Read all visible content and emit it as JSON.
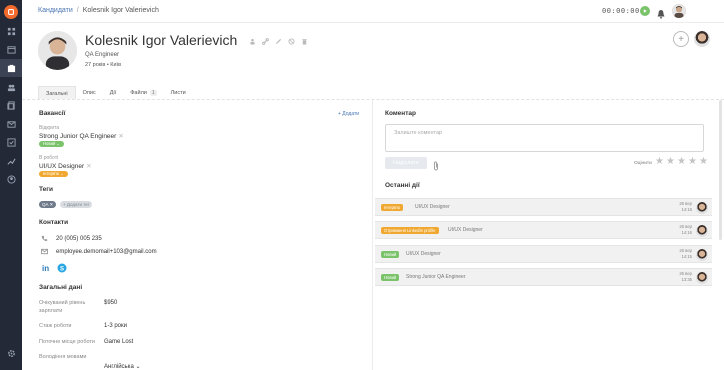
{
  "breadcrumb": {
    "parent": "Кандидати",
    "separator": "/",
    "current": "Kolesnik Igor Valerievich"
  },
  "timer": "00:00:00",
  "profile": {
    "name": "Kolesnik Igor Valerievich",
    "role": "QA Engineer",
    "meta": "27 років • Київ"
  },
  "tabs": [
    {
      "label": "Загальні",
      "active": true
    },
    {
      "label": "Опис"
    },
    {
      "label": "Дії"
    },
    {
      "label": "Файли",
      "badge": "1"
    },
    {
      "label": "Листи"
    }
  ],
  "vacancies": {
    "title": "Вакансії",
    "add": "+ Додати",
    "items": [
      {
        "status_label": "Відкрита",
        "title": "Strong Junior QA Engineer",
        "stage": "Новий ⌄",
        "stage_color": "#7ac36a"
      },
      {
        "status_label": "В роботі",
        "title": "UI/UX Designer",
        "stage": "Інтерв'ю ⌄",
        "stage_color": "#f0a830"
      }
    ]
  },
  "tags": {
    "title": "Теги",
    "items": [
      "QA ✕",
      "+ Додати тег"
    ]
  },
  "contacts": {
    "title": "Контакти",
    "phone": "20 (005) 005 235",
    "email": "employee.demomail+103@gmail.com"
  },
  "general": {
    "title": "Загальні дані",
    "fields": [
      {
        "label": "Очікуваний рівень зарплати",
        "value": "$950"
      },
      {
        "label": "Стаж роботи",
        "value": "1-3 роки"
      },
      {
        "label": "Поточне місце роботи",
        "value": "Game Lost"
      },
      {
        "label": "Володіння мовами",
        "value": "Англійська ⌄"
      }
    ]
  },
  "comment": {
    "title": "Коментар",
    "placeholder": "Залиште коментар",
    "publish": "Надіслати",
    "rate_label": "Оцінити",
    "stars": 5
  },
  "recent": {
    "title": "Останні дії",
    "items": [
      {
        "pill": "Інтерв'ю",
        "pill_color": "orange",
        "text": "UI/UX Designer",
        "date_day": "26 вер",
        "date_time": "14:16"
      },
      {
        "pill": "Отримання LinkedIn profile",
        "pill_color": "orange",
        "text": "UI/UX Designer",
        "date_day": "26 вер",
        "date_time": "14:16"
      },
      {
        "pill": "Новий",
        "pill_color": "green",
        "text": "UI/UX Designer",
        "date_day": "26 вер",
        "date_time": "14:15"
      },
      {
        "pill": "Новий",
        "pill_color": "green",
        "text": "Strong Junior QA Engineer",
        "date_day": "26 вер",
        "date_time": "13:35"
      }
    ]
  },
  "colors": {
    "sidebar": "#232937",
    "accent": "#4a76b3",
    "brand": "#f26a2c",
    "green": "#7ac36a",
    "orange": "#f0a830"
  }
}
